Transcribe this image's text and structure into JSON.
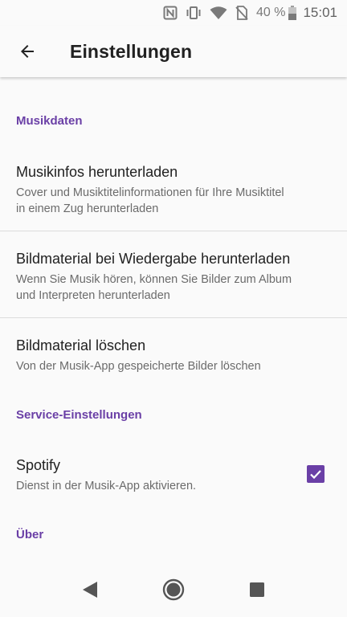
{
  "status_bar": {
    "battery_percent": "40 %",
    "time": "15:01",
    "icons": [
      "nfc-icon",
      "vibrate-icon",
      "wifi-icon",
      "no-sim-icon",
      "battery-icon"
    ]
  },
  "app_bar": {
    "title": "Einstellungen",
    "back_icon": "arrow-back-icon"
  },
  "sections": {
    "music_data": {
      "header": "Musikdaten",
      "items": [
        {
          "title": "Musikinfos herunterladen",
          "summary_line1": "Cover und Musiktitelinformationen für Ihre Musiktitel",
          "summary_line2": "in einem Zug herunterladen"
        },
        {
          "title": "Bildmaterial bei Wiedergabe herunterladen",
          "summary_line1": "Wenn Sie Musik hören, können Sie Bilder zum Album",
          "summary_line2": "und Interpreten herunterladen"
        },
        {
          "title": "Bildmaterial löschen",
          "summary_line1": "Von der Musik-App gespeicherte Bilder löschen"
        }
      ]
    },
    "service_settings": {
      "header": "Service-Einstellungen",
      "items": [
        {
          "title": "Spotify",
          "summary_line1": "Dienst in der Musik-App aktivieren.",
          "checked": true
        }
      ]
    },
    "about": {
      "header": "Über"
    }
  },
  "nav_bar": {
    "buttons": [
      "back-triangle-icon",
      "home-circle-icon",
      "recents-square-icon"
    ]
  },
  "colors": {
    "accent": "#6a3fa6",
    "background": "#fafafa",
    "text_primary": "#212121",
    "text_secondary": "#6b6b6b"
  }
}
